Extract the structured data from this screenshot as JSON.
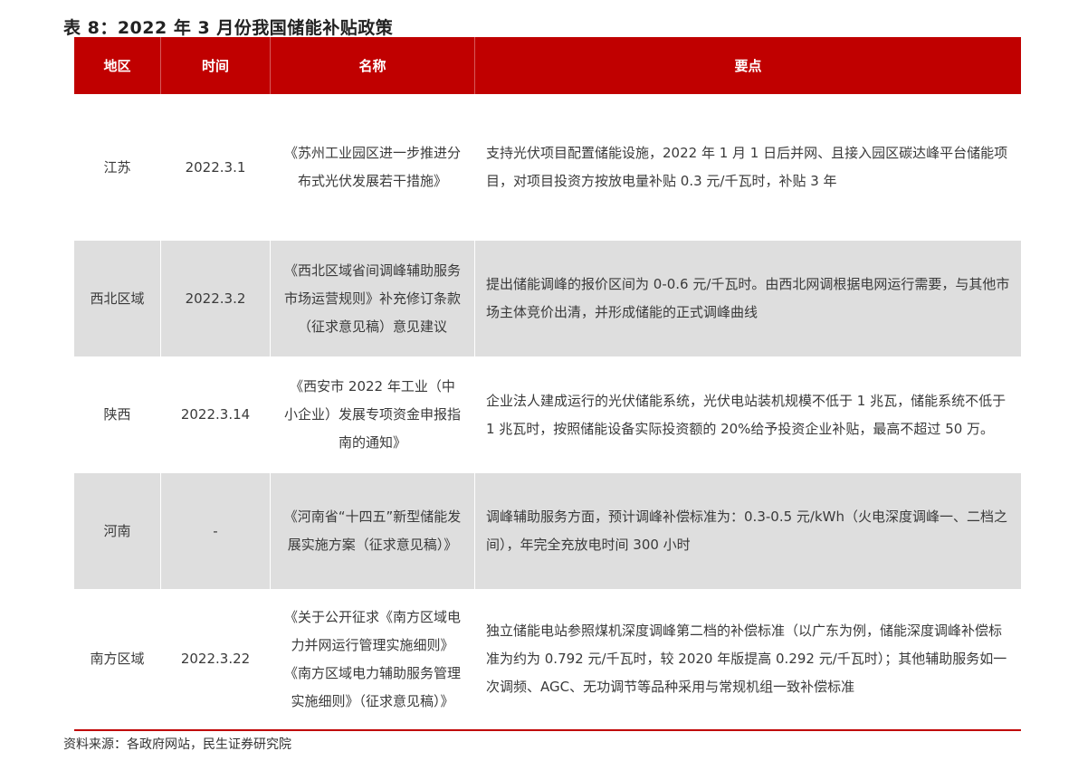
{
  "title": "表 8：2022 年 3 月份我国储能补贴政策",
  "table": {
    "headers": [
      "地区",
      "时间",
      "名称",
      "要点"
    ],
    "rows": [
      {
        "region": "江苏",
        "date": "2022.3.1",
        "name": "《苏州工业园区进一步推进分布式光伏发展若干措施》",
        "points": "支持光伏项目配置储能设施，2022 年 1 月 1 日后并网、且接入园区碳达峰平台储能项目，对项目投资方按放电量补贴 0.3 元/千瓦时，补贴 3 年"
      },
      {
        "region": "西北区域",
        "date": "2022.3.2",
        "name": "《西北区域省间调峰辅助服务市场运营规则》补充修订条款（征求意见稿）意见建议",
        "points": "提出储能调峰的报价区间为 0-0.6 元/千瓦时。由西北网调根据电网运行需要，与其他市场主体竞价出清，并形成储能的正式调峰曲线"
      },
      {
        "region": "陕西",
        "date": "2022.3.14",
        "name": "《西安市 2022 年工业（中小企业）发展专项资金申报指南的通知》",
        "points": "企业法人建成运行的光伏储能系统，光伏电站装机规模不低于 1 兆瓦，储能系统不低于 1 兆瓦时，按照储能设备实际投资额的 20%给予投资企业补贴，最高不超过 50 万。"
      },
      {
        "region": "河南",
        "date": "-",
        "name": "《河南省“十四五”新型储能发展实施方案（征求意见稿）》",
        "points": "调峰辅助服务方面，预计调峰补偿标准为：0.3-0.5 元/kWh（火电深度调峰一、二档之间），年完全充放电时间 300 小时"
      },
      {
        "region": "南方区域",
        "date": "2022.3.22",
        "name": "《关于公开征求《南方区域电力并网运行管理实施细则》《南方区域电力辅助服务管理实施细则》（征求意见稿）》",
        "points": "独立储能电站参照煤机深度调峰第二档的补偿标准（以广东为例，储能深度调峰补偿标准为约为 0.792  元/千瓦时，较 2020  年版提高 0.292  元/千瓦时）；其他辅助服务如一次调频、AGC、无功调节等品种采用与常规机组一致补偿标准"
      }
    ]
  },
  "source": "资料来源：各政府网站，民生证券研究院",
  "colors": {
    "header_bg": "#c00000",
    "shade_bg": "#dedede"
  }
}
